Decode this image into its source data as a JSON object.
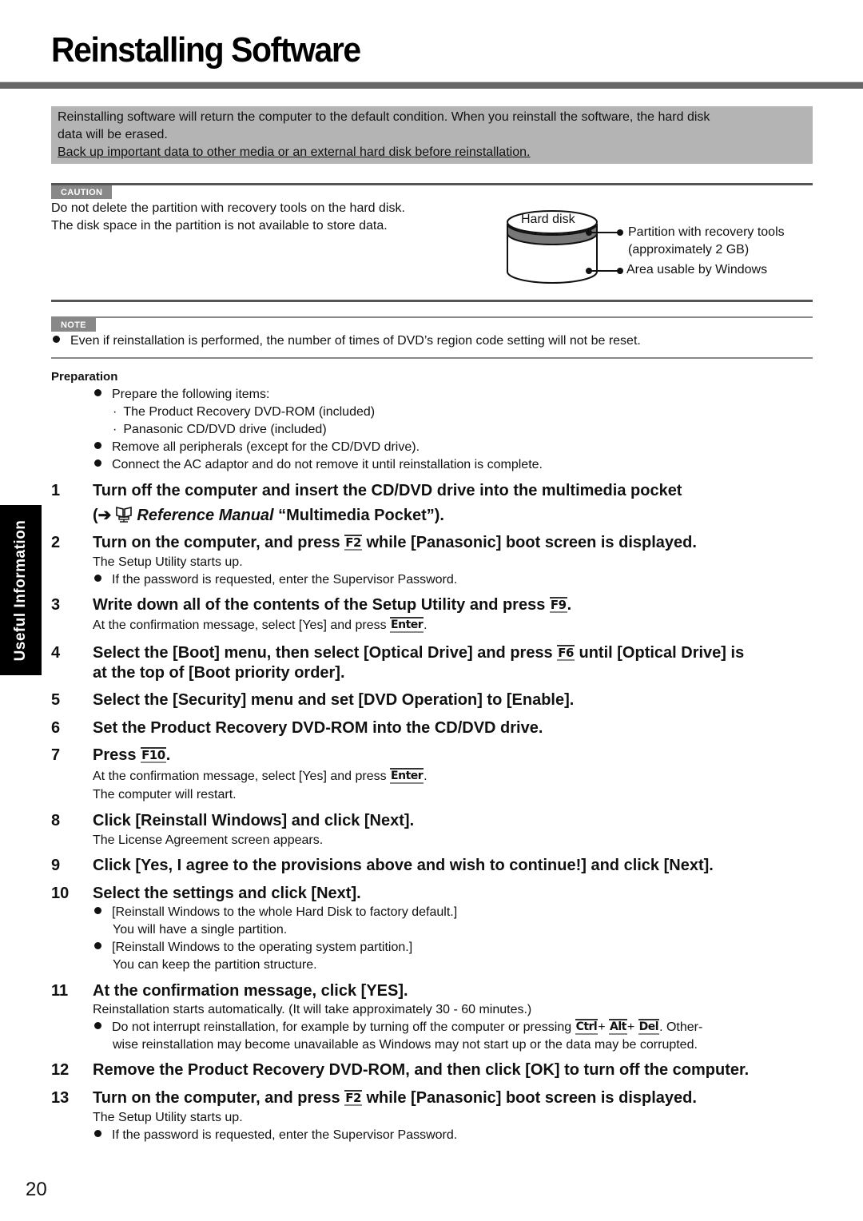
{
  "page": {
    "title": "Reinstalling Software",
    "number": "20",
    "side_tab": "Useful Information"
  },
  "intro": {
    "line1": "Reinstalling software will return the computer to the default condition. When you reinstall the software, the hard disk",
    "line2": "data will be erased.",
    "line3": "Back up important data to other media or an external hard disk before reinstallation."
  },
  "caution": {
    "tag": "CAUTION",
    "line1": "Do not delete the partition with recovery tools on the hard disk.",
    "line2": "The disk space in the partition is not available to store data.",
    "diagram": {
      "disk_label": "Hard disk",
      "partition_label_1": "Partition with recovery tools",
      "partition_label_2": "(approximately 2 GB)",
      "area_label": "Area usable by Windows"
    }
  },
  "note": {
    "tag": "NOTE",
    "text": "Even if reinstallation is performed, the number of times of DVD’s region code setting will not be reset."
  },
  "preparation": {
    "heading": "Preparation",
    "items": [
      "Prepare the following items:",
      "The Product Recovery DVD-ROM (included)",
      "Panasonic CD/DVD drive (included)",
      "Remove all peripherals (except for the CD/DVD drive).",
      "Connect the AC adaptor and do not remove it until reinstallation is complete."
    ]
  },
  "keys": {
    "f2": "F2",
    "f9": "F9",
    "f6": "F6",
    "f10": "F10",
    "enter": "Enter",
    "ctrl": "Ctrl",
    "alt": "Alt",
    "del": "Del"
  },
  "steps": [
    {
      "num": "1",
      "text": "Turn off the computer and insert the CD/DVD drive into the multimedia pocket",
      "cont_open": "(➔",
      "cont_italic": "Reference Manual",
      "cont_rest": " “Multimedia Pocket”)."
    },
    {
      "num": "2",
      "pre": "Turn on the computer, and press ",
      "post": " while [Panasonic] boot screen is displayed.",
      "sub1": "The Setup Utility starts up.",
      "bullet1": "If the password is requested, enter the Supervisor Password."
    },
    {
      "num": "3",
      "pre": "Write down all of the contents of the Setup Utility and press ",
      "post": ".",
      "sub_pre": "At the confirmation message, select [Yes] and press ",
      "sub_post": "."
    },
    {
      "num": "4",
      "pre": "Select the [Boot] menu, then select [Optical Drive] and press ",
      "post": " until [Optical Drive] is",
      "cont": "at the top of [Boot priority order]."
    },
    {
      "num": "5",
      "text": "Select the [Security] menu and set [DVD Operation] to [Enable]."
    },
    {
      "num": "6",
      "text": "Set the Product Recovery DVD-ROM into the CD/DVD drive."
    },
    {
      "num": "7",
      "pre": "Press ",
      "post": ".",
      "sub_pre": "At the confirmation message, select [Yes] and press ",
      "sub_post": ".",
      "sub2": "The computer will restart."
    },
    {
      "num": "8",
      "text": "Click [Reinstall Windows] and click [Next].",
      "sub1": "The License Agreement screen appears."
    },
    {
      "num": "9",
      "text": "Click [Yes, I agree to the provisions above and wish to continue!] and click [Next]."
    },
    {
      "num": "10",
      "text": "Select the settings and click [Next].",
      "b1": "[Reinstall Windows to the whole Hard Disk to factory default.]",
      "b1_sub": "You will have a single partition.",
      "b2": "[Reinstall Windows to the operating system partition.]",
      "b2_sub": "You can keep the partition structure."
    },
    {
      "num": "11",
      "text": "At the confirmation message, click [YES].",
      "sub1": "Reinstallation starts automatically. (It will take approximately 30 - 60 minutes.)",
      "bullet_pre": "Do not interrupt reinstallation, for example by turning off the computer or pressing ",
      "plus": "+ ",
      "bullet_post": ". Other-",
      "bullet_cont": "wise reinstallation may become unavailable as Windows may not start up or the data may be corrupted."
    },
    {
      "num": "12",
      "text": "Remove the Product Recovery DVD-ROM, and then click [OK] to turn off the computer."
    },
    {
      "num": "13",
      "pre": "Turn on the computer, and press ",
      "post": " while [Panasonic] boot screen is displayed.",
      "sub1": "The Setup Utility starts up.",
      "bullet1": "If the password is requested, enter the Supervisor Password."
    }
  ]
}
